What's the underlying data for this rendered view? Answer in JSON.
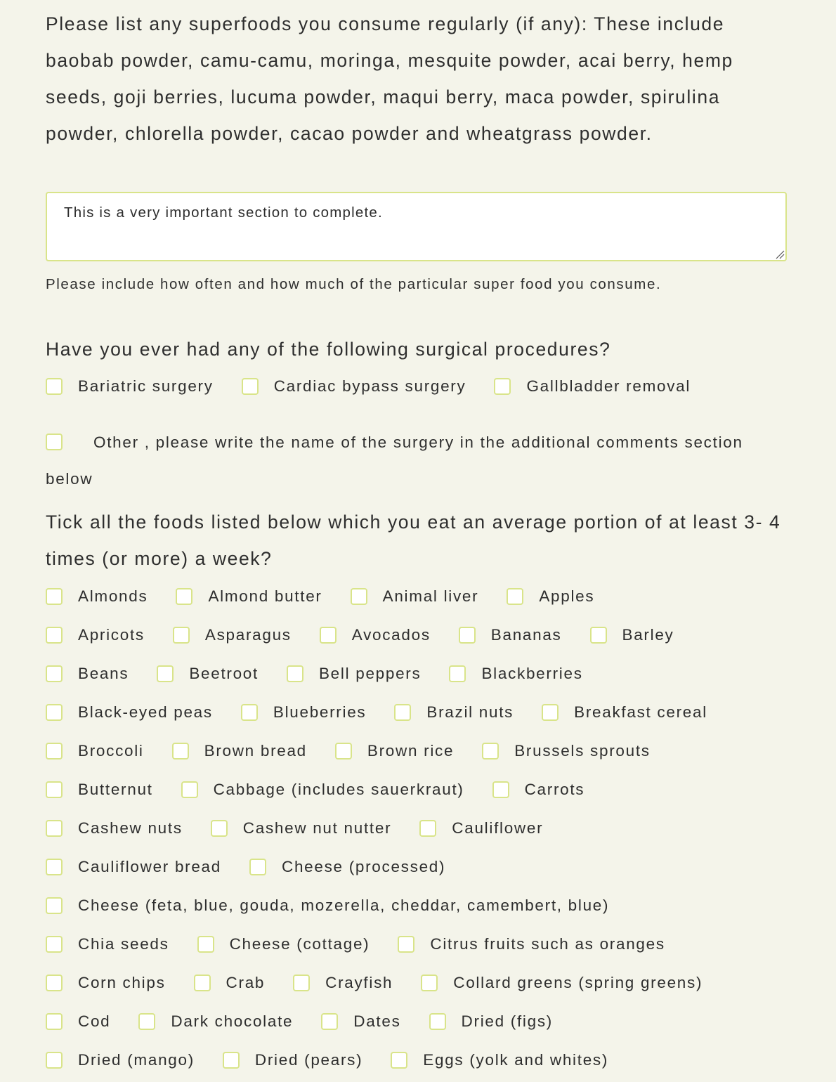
{
  "superfoods": {
    "question": "Please list any superfoods you consume regularly (if any): These include baobab powder, camu-camu, moringa, mesquite powder, acai berry, hemp seeds, goji berries, lucuma powder, maqui berry, maca powder, spirulina powder, chlorella powder, cacao powder and wheatgrass powder.",
    "textarea_value": "This is a very important section to complete.",
    "help_text": "Please include how often and how much of the particular super food you consume."
  },
  "surgery": {
    "question": "Have you ever had any of the following surgical procedures?",
    "options": [
      "Bariatric surgery",
      "Cardiac bypass surgery",
      "Gallbladder removal",
      "Other , please write the name of the surgery in the additional comments section below"
    ]
  },
  "foods": {
    "question": "Tick all the foods listed below which you eat an average portion of at least 3- 4 times (or more) a week?",
    "rows": [
      [
        "Almonds",
        "Almond butter",
        "Animal liver",
        "Apples"
      ],
      [
        "Apricots",
        "Asparagus",
        "Avocados",
        "Bananas",
        "Barley"
      ],
      [
        "Beans",
        "Beetroot",
        "Bell peppers",
        "Blackberries"
      ],
      [
        "Black-eyed peas",
        "Blueberries",
        "Brazil nuts",
        "Breakfast cereal"
      ],
      [
        "Broccoli",
        "Brown bread",
        "Brown rice",
        "Brussels sprouts"
      ],
      [
        "Butternut",
        "Cabbage (includes sauerkraut)",
        "Carrots"
      ],
      [
        "Cashew nuts",
        "Cashew nut nutter",
        "Cauliflower"
      ],
      [
        "Cauliflower bread",
        "Cheese (processed)"
      ],
      [
        "Cheese (feta, blue, gouda, mozerella, cheddar, camembert, blue)"
      ],
      [
        "Chia seeds",
        "Cheese (cottage)",
        "Citrus fruits such as oranges"
      ],
      [
        "Corn chips",
        "Crab",
        "Crayfish",
        "Collard greens (spring greens)"
      ],
      [
        "Cod",
        "Dark chocolate",
        "Dates",
        "Dried (figs)"
      ],
      [
        "Dried (mango)",
        "Dried (pears)",
        "Eggs (yolk and whites)"
      ]
    ]
  },
  "colors": {
    "background": "#f4f4ea",
    "checkbox_border": "#d9e48a",
    "text": "#2e2e2e"
  }
}
